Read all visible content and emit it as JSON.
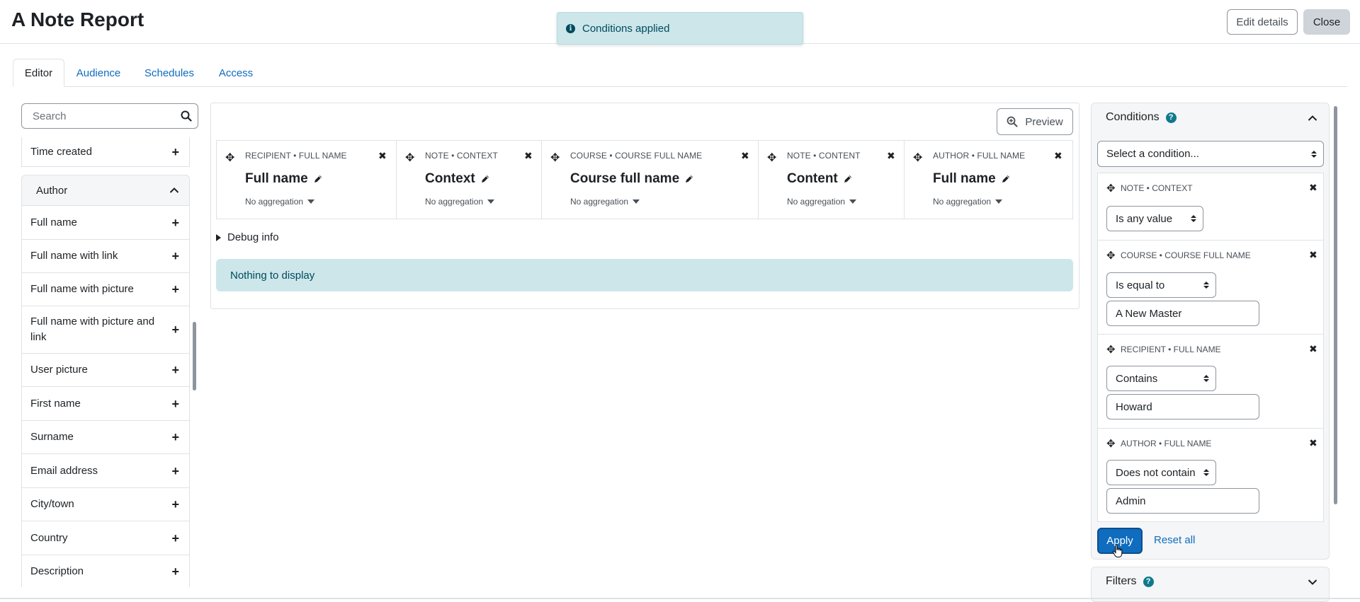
{
  "header": {
    "title": "A Note Report",
    "edit_details_label": "Edit details",
    "close_label": "Close"
  },
  "toast": {
    "message": "Conditions applied"
  },
  "tabs": [
    {
      "label": "Editor",
      "active": true
    },
    {
      "label": "Audience",
      "active": false
    },
    {
      "label": "Schedules",
      "active": false
    },
    {
      "label": "Access",
      "active": false
    }
  ],
  "sidebar": {
    "search_placeholder": "Search",
    "items_above": [
      {
        "label": "Time created"
      }
    ],
    "group": {
      "label": "Author",
      "expanded": true
    },
    "group_items": [
      {
        "label": "Full name"
      },
      {
        "label": "Full name with link"
      },
      {
        "label": "Full name with picture"
      },
      {
        "label": "Full name with picture and link"
      },
      {
        "label": "User picture"
      },
      {
        "label": "First name"
      },
      {
        "label": "Surname"
      },
      {
        "label": "Email address"
      },
      {
        "label": "City/town"
      },
      {
        "label": "Country"
      },
      {
        "label": "Description"
      }
    ]
  },
  "main": {
    "preview_label": "Preview",
    "columns": [
      {
        "caption": "RECIPIENT • FULL NAME",
        "title": "Full name",
        "aggregation": "No aggregation"
      },
      {
        "caption": "NOTE • CONTEXT",
        "title": "Context",
        "aggregation": "No aggregation"
      },
      {
        "caption": "COURSE • COURSE FULL NAME",
        "title": "Course full name",
        "aggregation": "No aggregation"
      },
      {
        "caption": "NOTE • CONTENT",
        "title": "Content",
        "aggregation": "No aggregation"
      },
      {
        "caption": "AUTHOR • FULL NAME",
        "title": "Full name",
        "aggregation": "No aggregation"
      }
    ],
    "debug_label": "Debug info",
    "empty_message": "Nothing to display"
  },
  "conditions": {
    "title": "Conditions",
    "select_placeholder": "Select a condition...",
    "items": [
      {
        "caption": "NOTE • CONTEXT",
        "operator": "Is any value",
        "value": null
      },
      {
        "caption": "COURSE • COURSE FULL NAME",
        "operator": "Is equal to",
        "value": "A New Master"
      },
      {
        "caption": "RECIPIENT • FULL NAME",
        "operator": "Contains",
        "value": "Howard"
      },
      {
        "caption": "AUTHOR • FULL NAME",
        "operator": "Does not contain",
        "value": "Admin"
      }
    ],
    "apply_label": "Apply",
    "reset_label": "Reset all"
  },
  "filters": {
    "title": "Filters"
  },
  "colors": {
    "link": "#0f6cbf",
    "info_bg": "#cce6ea",
    "info_text": "#004a5c",
    "help_icon": "#0f7a8c",
    "border": "#dee2e6"
  }
}
